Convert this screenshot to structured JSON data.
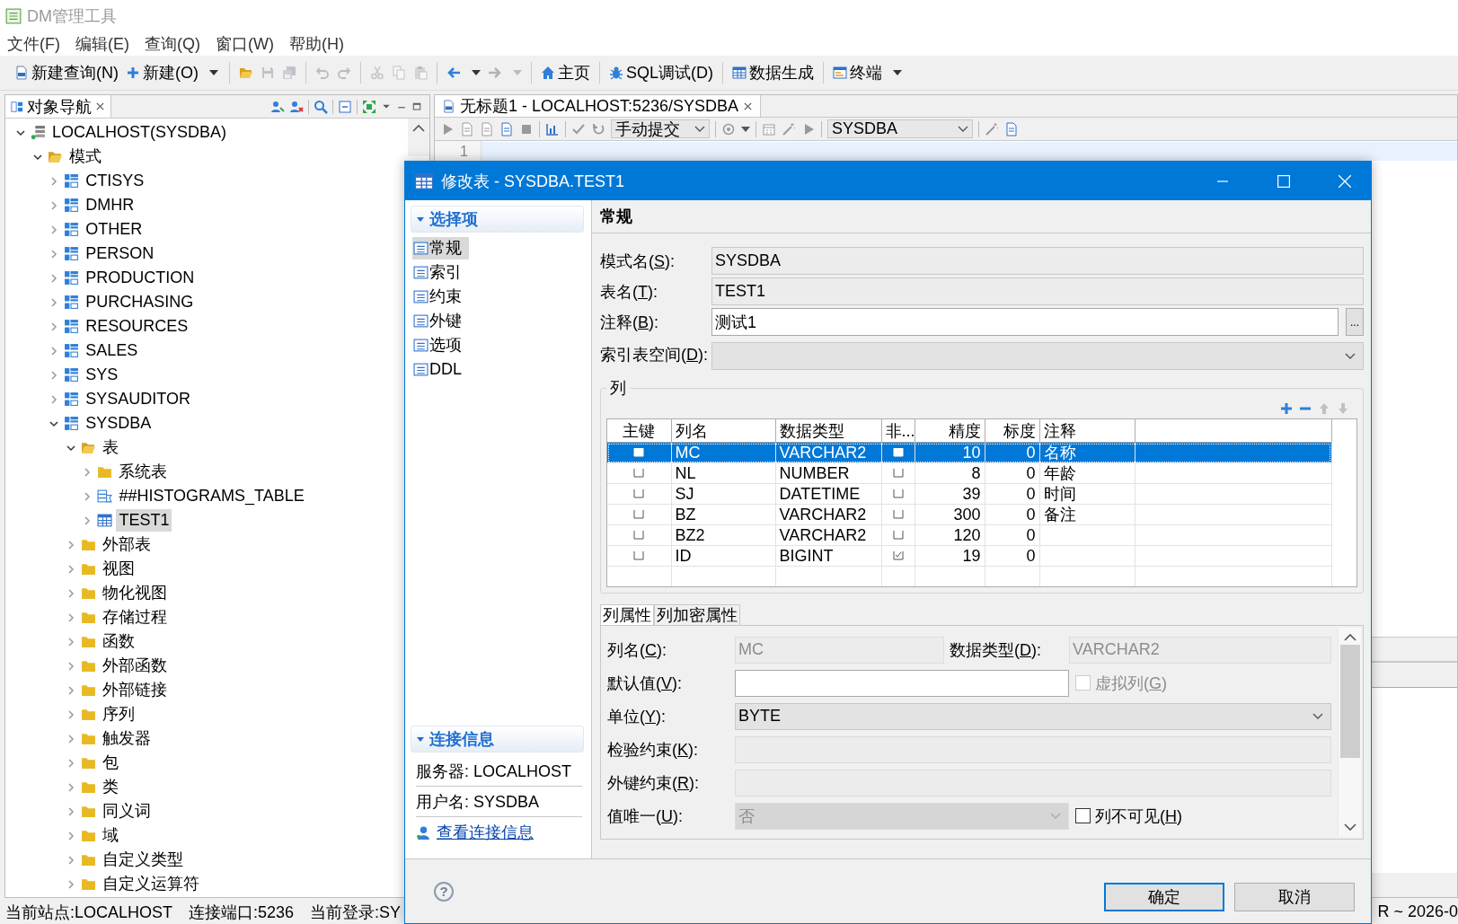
{
  "window": {
    "title": "DM管理工具"
  },
  "menu": [
    "文件(F)",
    "编辑(E)",
    "查询(Q)",
    "窗口(W)",
    "帮助(H)"
  ],
  "toolbar": [
    {
      "kind": "button",
      "label": "新建查询(N)"
    },
    {
      "kind": "split",
      "label": "新建(O)"
    },
    {
      "kind": "separator"
    },
    {
      "kind": "icon",
      "disabled": false
    },
    {
      "kind": "icon",
      "disabled": true
    },
    {
      "kind": "icon",
      "disabled": true
    },
    {
      "kind": "separator"
    },
    {
      "kind": "icon",
      "disabled": true
    },
    {
      "kind": "icon",
      "disabled": true
    },
    {
      "kind": "separator"
    },
    {
      "kind": "icon",
      "disabled": true
    },
    {
      "kind": "icon",
      "disabled": true
    },
    {
      "kind": "icon",
      "disabled": true
    },
    {
      "kind": "separator"
    },
    {
      "kind": "icon-split",
      "disabled": false
    },
    {
      "kind": "icon-split",
      "disabled": true
    },
    {
      "kind": "separator"
    },
    {
      "kind": "button",
      "label": "主页"
    },
    {
      "kind": "separator"
    },
    {
      "kind": "button",
      "label": "SQL调试(D)"
    },
    {
      "kind": "separator"
    },
    {
      "kind": "button",
      "label": "数据生成"
    },
    {
      "kind": "separator"
    },
    {
      "kind": "split",
      "label": "终端"
    }
  ],
  "navigator": {
    "title": "对象导航",
    "tree": [
      {
        "label": "LOCALHOST(SYSDBA)",
        "kind": "server",
        "expanded": true,
        "selected": false,
        "children": [
          {
            "label": "模式",
            "kind": "folder",
            "expanded": true,
            "selected": false,
            "children": [
              {
                "label": "CTISYS",
                "kind": "schema",
                "expanded": false,
                "selected": false
              },
              {
                "label": "DMHR",
                "kind": "schema",
                "expanded": false,
                "selected": false
              },
              {
                "label": "OTHER",
                "kind": "schema",
                "expanded": false,
                "selected": false
              },
              {
                "label": "PERSON",
                "kind": "schema",
                "expanded": false,
                "selected": false
              },
              {
                "label": "PRODUCTION",
                "kind": "schema",
                "expanded": false,
                "selected": false
              },
              {
                "label": "PURCHASING",
                "kind": "schema",
                "expanded": false,
                "selected": false
              },
              {
                "label": "RESOURCES",
                "kind": "schema",
                "expanded": false,
                "selected": false
              },
              {
                "label": "SALES",
                "kind": "schema",
                "expanded": false,
                "selected": false
              },
              {
                "label": "SYS",
                "kind": "schema",
                "expanded": false,
                "selected": false
              },
              {
                "label": "SYSAUDITOR",
                "kind": "schema",
                "expanded": false,
                "selected": false
              },
              {
                "label": "SYSDBA",
                "kind": "schema",
                "expanded": true,
                "selected": false,
                "children": [
                  {
                    "label": "表",
                    "kind": "folder",
                    "expanded": true,
                    "selected": false,
                    "children": [
                      {
                        "label": "系统表",
                        "kind": "folder",
                        "expanded": false,
                        "selected": false
                      },
                      {
                        "label": "##HISTOGRAMS_TABLE",
                        "kind": "list-table",
                        "expanded": false,
                        "selected": false
                      },
                      {
                        "label": "TEST1",
                        "kind": "table",
                        "expanded": false,
                        "selected": true
                      }
                    ]
                  },
                  {
                    "label": "外部表",
                    "kind": "folder",
                    "expanded": false,
                    "selected": false
                  },
                  {
                    "label": "视图",
                    "kind": "folder",
                    "expanded": false,
                    "selected": false
                  },
                  {
                    "label": "物化视图",
                    "kind": "folder",
                    "expanded": false,
                    "selected": false
                  },
                  {
                    "label": "存储过程",
                    "kind": "folder",
                    "expanded": false,
                    "selected": false
                  },
                  {
                    "label": "函数",
                    "kind": "folder",
                    "expanded": false,
                    "selected": false
                  },
                  {
                    "label": "外部函数",
                    "kind": "folder",
                    "expanded": false,
                    "selected": false
                  },
                  {
                    "label": "外部链接",
                    "kind": "folder",
                    "expanded": false,
                    "selected": false
                  },
                  {
                    "label": "序列",
                    "kind": "folder",
                    "expanded": false,
                    "selected": false
                  },
                  {
                    "label": "触发器",
                    "kind": "folder",
                    "expanded": false,
                    "selected": false
                  },
                  {
                    "label": "包",
                    "kind": "folder",
                    "expanded": false,
                    "selected": false
                  },
                  {
                    "label": "类",
                    "kind": "folder",
                    "expanded": false,
                    "selected": false
                  },
                  {
                    "label": "同义词",
                    "kind": "folder",
                    "expanded": false,
                    "selected": false
                  },
                  {
                    "label": "域",
                    "kind": "folder",
                    "expanded": false,
                    "selected": false
                  },
                  {
                    "label": "自定义类型",
                    "kind": "folder",
                    "expanded": false,
                    "selected": false
                  },
                  {
                    "label": "自定义运算符",
                    "kind": "folder",
                    "expanded": false,
                    "selected": false
                  }
                ]
              }
            ]
          }
        ]
      }
    ]
  },
  "editor": {
    "tab": "无标题1 - LOCALHOST:5236/SYSDBA",
    "commit_mode": "手动提交",
    "schema": "SYSDBA",
    "line_numbers": [
      "1"
    ]
  },
  "status_bar": [
    "当前站点:LOCALHOST",
    "连接端口:5236",
    "当前登录:SY",
    "R ~ 2026-0"
  ],
  "dialog": {
    "title": "修改表 - SYSDBA.TEST1",
    "options_header": "选择项",
    "options": [
      {
        "label": "常规",
        "selected": true
      },
      {
        "label": "索引",
        "selected": false
      },
      {
        "label": "约束",
        "selected": false
      },
      {
        "label": "外键",
        "selected": false
      },
      {
        "label": "选项",
        "selected": false
      },
      {
        "label": "DDL",
        "selected": false
      }
    ],
    "connection_header": "连接信息",
    "connection": [
      {
        "kind": "text",
        "text": "服务器: LOCALHOST"
      },
      {
        "kind": "text",
        "text": "用户名: SYSDBA"
      },
      {
        "kind": "link",
        "text": "查看连接信息"
      }
    ],
    "section_title": "常规",
    "fields": [
      {
        "kind": "readonly",
        "label": "模式名(S):",
        "value": "SYSDBA"
      },
      {
        "kind": "readonly",
        "label": "表名(T):",
        "value": "TEST1"
      },
      {
        "kind": "text-more",
        "label": "注释(B):",
        "value": "测试1",
        "button": "..."
      },
      {
        "kind": "select",
        "label": "索引表空间(D):"
      }
    ],
    "columns_title": "列",
    "column_tools": [
      {
        "disabled": false
      },
      {
        "disabled": false
      },
      {
        "disabled": true
      },
      {
        "disabled": true
      }
    ],
    "table": {
      "columns": [
        "主键",
        "列名",
        "数据类型",
        "非...",
        "精度",
        "标度",
        "注释"
      ],
      "rows": [
        {
          "selected": true,
          "primary_key": false,
          "name": "MC",
          "type": "VARCHAR2",
          "not_null": false,
          "precision": "10",
          "scale": "0",
          "comment": "名称"
        },
        {
          "selected": false,
          "primary_key": false,
          "name": "NL",
          "type": "NUMBER",
          "not_null": false,
          "precision": "8",
          "scale": "0",
          "comment": "年龄"
        },
        {
          "selected": false,
          "primary_key": false,
          "name": "SJ",
          "type": "DATETIME",
          "not_null": false,
          "precision": "39",
          "scale": "0",
          "comment": "时间"
        },
        {
          "selected": false,
          "primary_key": false,
          "name": "BZ",
          "type": "VARCHAR2",
          "not_null": false,
          "precision": "300",
          "scale": "0",
          "comment": "备注"
        },
        {
          "selected": false,
          "primary_key": false,
          "name": "BZ2",
          "type": "VARCHAR2",
          "not_null": false,
          "precision": "120",
          "scale": "0"
        },
        {
          "selected": false,
          "primary_key": false,
          "name": "ID",
          "type": "BIGINT",
          "not_null": true,
          "precision": "19",
          "scale": "0"
        }
      ]
    },
    "property_tabs": [
      {
        "label": "列属性",
        "selected": true
      },
      {
        "label": "列加密属性",
        "selected": false
      }
    ],
    "properties": [
      {
        "kind": "text",
        "label": "列名(C):",
        "value": "MC",
        "disabled": true,
        "side": {
          "kind": "text",
          "label": "数据类型(D):",
          "value": "VARCHAR2",
          "disabled": true
        }
      },
      {
        "kind": "text",
        "label": "默认值(V):",
        "disabled": false,
        "side": {
          "kind": "checkbox",
          "label": "虚拟列(G)",
          "checked": false,
          "disabled": true
        }
      },
      {
        "kind": "select",
        "label": "单位(Y):",
        "value": "BYTE",
        "disabled": false
      },
      {
        "kind": "text",
        "label": "检验约束(K):",
        "disabled": true
      },
      {
        "kind": "text",
        "label": "外键约束(R):",
        "disabled": true
      },
      {
        "kind": "select",
        "label": "值唯一(U):",
        "value": "否",
        "disabled": true,
        "side": {
          "kind": "checkbox",
          "label": "列不可见(H)",
          "checked": false,
          "disabled": false
        }
      }
    ],
    "help": "?",
    "buttons": [
      {
        "label": "确定",
        "default": true
      },
      {
        "label": "取消",
        "default": false
      }
    ]
  }
}
